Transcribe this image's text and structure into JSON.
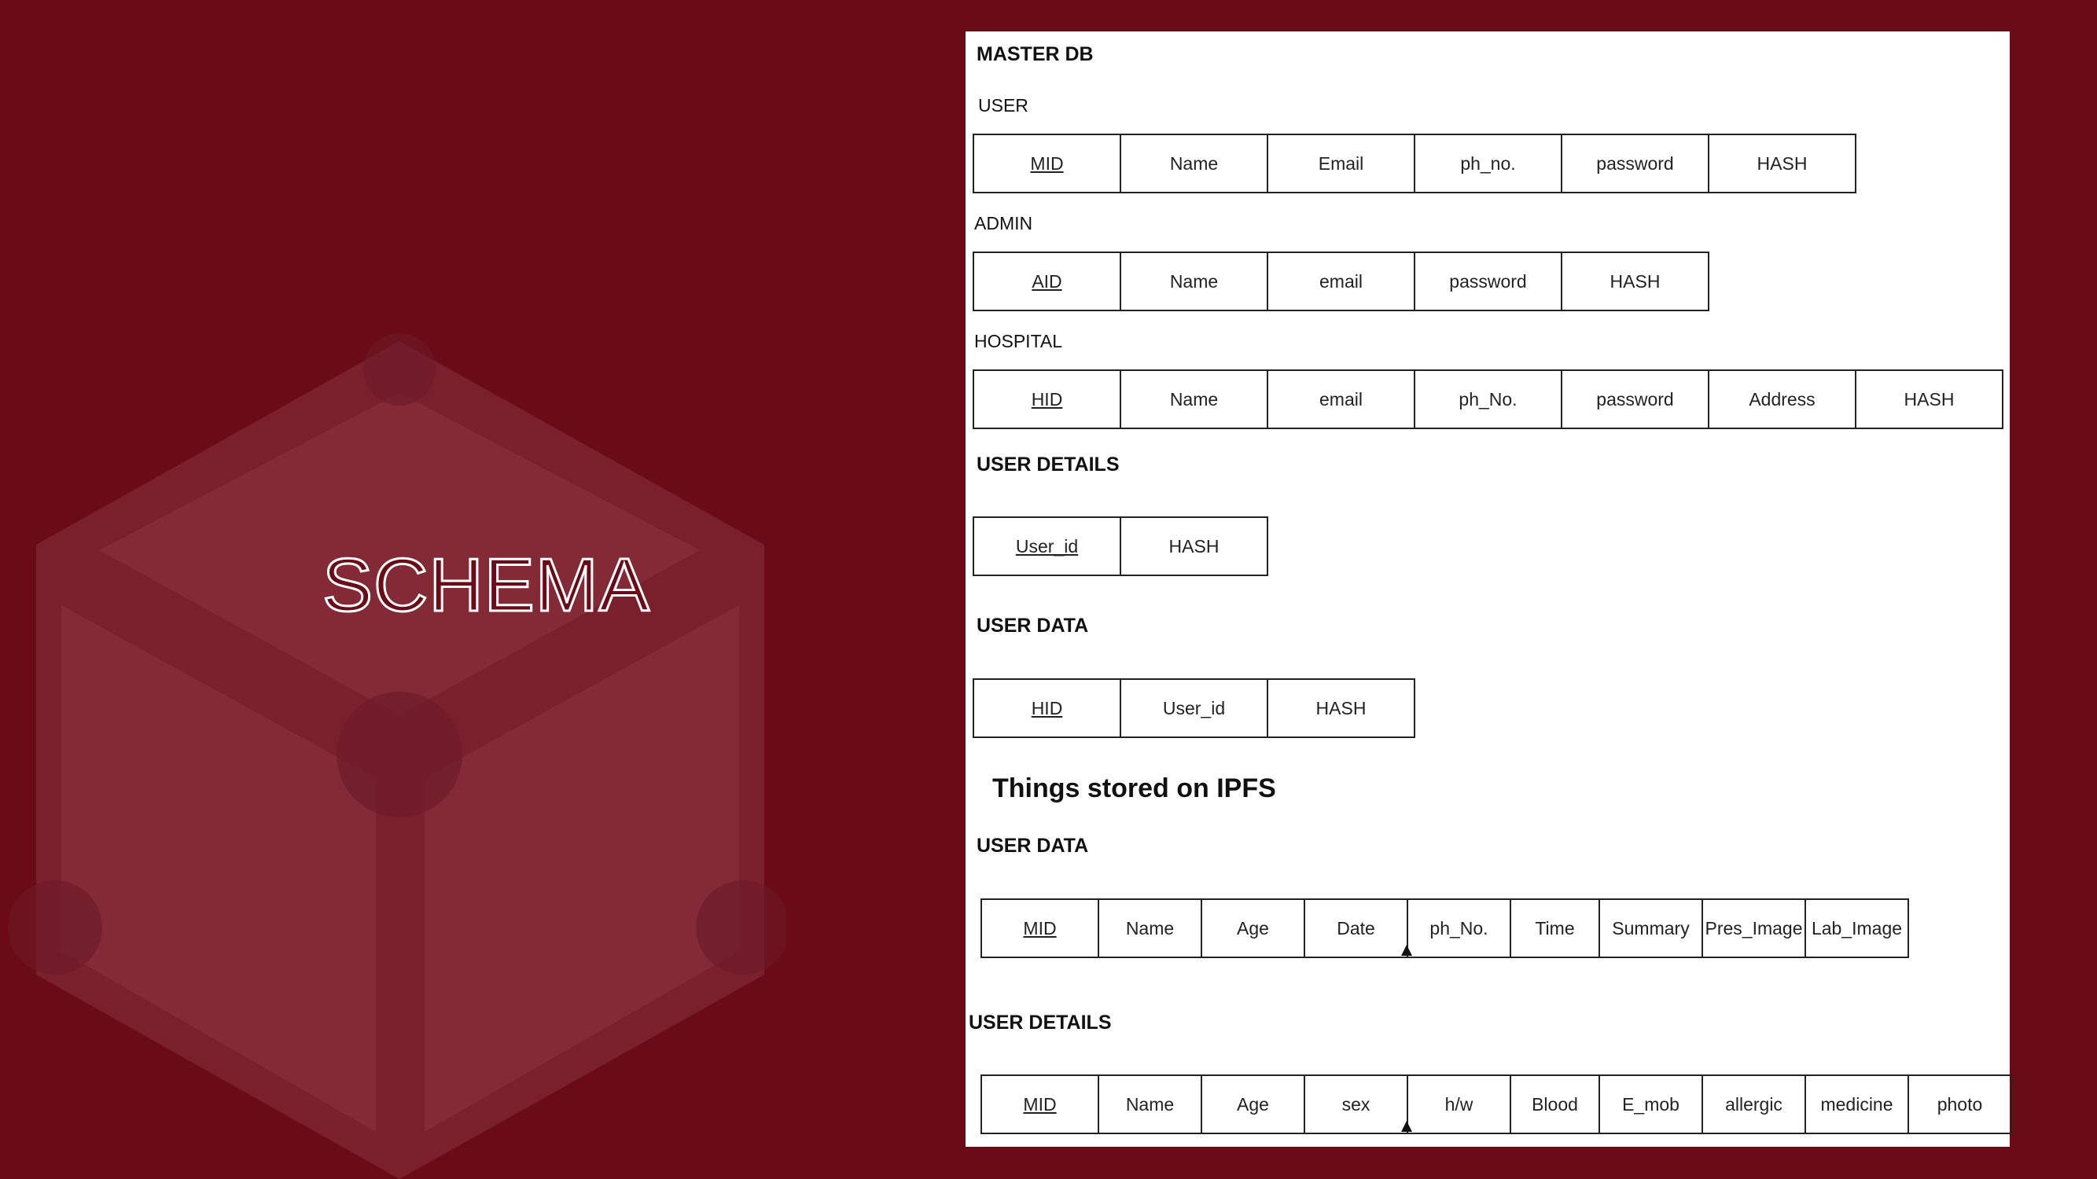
{
  "slide": {
    "title": "SCHEMA",
    "background": "#6b0b17",
    "cube_color": "#7c2430"
  },
  "panel": {
    "heading": "MASTER DB",
    "tables": [
      {
        "label": "USER",
        "label_style": "plain",
        "columns": [
          "MID",
          "Name",
          "Email",
          "ph_no.",
          "password",
          "HASH"
        ],
        "key_index": 0
      },
      {
        "label": "ADMIN",
        "label_style": "plain",
        "columns": [
          "AID",
          "Name",
          "email",
          "password",
          "HASH"
        ],
        "key_index": 0
      },
      {
        "label": "HOSPITAL",
        "label_style": "plain",
        "columns": [
          "HID",
          "Name",
          "email",
          "ph_No.",
          "password",
          "Address",
          "HASH"
        ],
        "key_index": 0
      },
      {
        "label": "USER DETAILS",
        "label_style": "bold",
        "columns": [
          "User_id",
          "HASH"
        ],
        "key_index": 0
      },
      {
        "label": "USER DATA",
        "label_style": "bold",
        "columns": [
          "HID",
          "User_id",
          "HASH"
        ],
        "key_index": 0
      }
    ],
    "ipfs_heading": "Things stored on IPFS",
    "ipfs_tables": [
      {
        "label": "USER DATA",
        "columns": [
          "MID",
          "Name",
          "Age",
          "Date",
          "ph_No.",
          "Time",
          "Summary",
          "Pres_Image",
          "Lab_Image"
        ],
        "key_index": 0
      },
      {
        "label": "USER DETAILS",
        "columns": [
          "MID",
          "Name",
          "Age",
          "sex",
          "h/w",
          "Blood",
          "E_mob",
          "allergic",
          "medicine",
          "photo"
        ],
        "key_index": 0
      }
    ]
  }
}
